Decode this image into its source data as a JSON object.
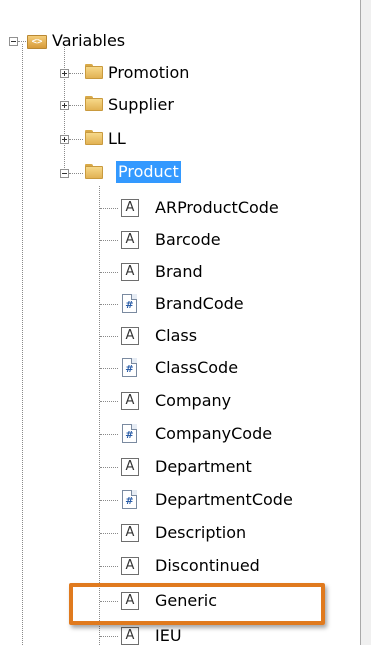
{
  "tree": {
    "root": {
      "label": "Variables",
      "icon": "variables-folder-icon",
      "glyph": "<>"
    },
    "folders": [
      {
        "label": "Promotion",
        "state": "collapsed"
      },
      {
        "label": "Supplier",
        "state": "collapsed"
      },
      {
        "label": "LL",
        "state": "collapsed"
      },
      {
        "label": "Product",
        "state": "expanded",
        "selected": true
      }
    ],
    "variables": [
      {
        "label": "ARProductCode",
        "type": "text",
        "glyph": "A"
      },
      {
        "label": "Barcode",
        "type": "text",
        "glyph": "A"
      },
      {
        "label": "Brand",
        "type": "text",
        "glyph": "A"
      },
      {
        "label": "BrandCode",
        "type": "number",
        "glyph": "#"
      },
      {
        "label": "Class",
        "type": "text",
        "glyph": "A"
      },
      {
        "label": "ClassCode",
        "type": "number",
        "glyph": "#"
      },
      {
        "label": "Company",
        "type": "text",
        "glyph": "A"
      },
      {
        "label": "CompanyCode",
        "type": "number",
        "glyph": "#"
      },
      {
        "label": "Department",
        "type": "text",
        "glyph": "A"
      },
      {
        "label": "DepartmentCode",
        "type": "number",
        "glyph": "#"
      },
      {
        "label": "Description",
        "type": "text",
        "glyph": "A"
      },
      {
        "label": "Discontinued",
        "type": "text",
        "glyph": "A"
      },
      {
        "label": "Generic",
        "type": "text",
        "glyph": "A",
        "highlighted": true
      },
      {
        "label": "IEU",
        "type": "text",
        "glyph": "A"
      }
    ]
  },
  "colors": {
    "selection": "#3399ff",
    "highlight_outline": "#e07a1e"
  }
}
